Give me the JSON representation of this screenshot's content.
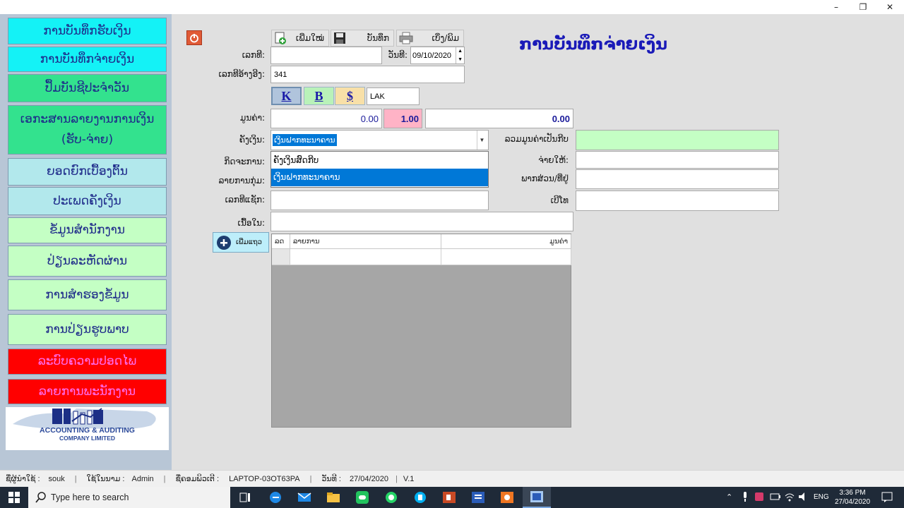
{
  "window": {
    "minimize": "–",
    "maximize": "❐",
    "close": "✕"
  },
  "sidebar": {
    "items": [
      {
        "label": "ການບັນທຶກຮັບເງິນ",
        "color": "#14f2f6"
      },
      {
        "label": "ການບັນທຶກຈ່າຍເງິນ",
        "color": "#14f2f6"
      },
      {
        "label": "ປຶ້ມບັນຊີປະຈຳວັນ",
        "color": "#33e28e"
      },
      {
        "label": "ເອກະສານລາຍງານການເງິນ (ຮັບ-ຈ່າຍ)",
        "color": "#33e28e"
      },
      {
        "label": "ຍອດຍົກເບື້ອງຕົ້ນ",
        "color": "#b2e8ec"
      },
      {
        "label": "ປະເພດຄັງເງິນ",
        "color": "#b2e8ec"
      },
      {
        "label": "ຂໍ້ມູນສຳນັກງານ",
        "color": "#c4ffc4"
      },
      {
        "label": "ປ່ຽນລະຫັດຜ່ານ",
        "color": "#c4ffc4"
      },
      {
        "label": "ການສຳຮອງຂໍ້ມູນ",
        "color": "#c4ffc4"
      },
      {
        "label": "ການປ່ຽນຮູບພາບ",
        "color": "#c4ffc4"
      },
      {
        "label": "ລະບົບຄວາມປອດໄພ",
        "color": "#ff0000"
      },
      {
        "label": "ລາຍການພະນັກງານ",
        "color": "#ff0000"
      }
    ],
    "logo": {
      "line1": "ACCOUNTING & AUDITING",
      "line2": "COMPANY LIMITED"
    }
  },
  "toolbar": {
    "new_label": "ເພີ່ມໃໝ່",
    "save_label": "ບັນທຶກ",
    "print_label": "ເບິ່ງ/ພິມ"
  },
  "form": {
    "title": "ການບັນທຶກຈ່າຍເງິນ",
    "number_label": "ເລກທີ:",
    "number_value": "",
    "date_label": "ວັນທີ:",
    "date_value": "09/10/2020",
    "ref_label": "ເລກທີອ້າງອີງ:",
    "ref_value": "341",
    "currency_k": "K",
    "currency_b": "B",
    "currency_s": "$",
    "currency_code": "LAK",
    "amount_label": "ມູນຄ່າ:",
    "amount_value": "0.00",
    "rate_value": "1.00",
    "total_value": "0.00",
    "cash_label": "ຄັງເງິນ:",
    "cash_selected": "ເງິນຝາກທະນາຄານ",
    "cash_options": [
      "ຄັງເງິນສົດກີບ",
      "ເງິນຝາກທະນາຄານ"
    ],
    "activity_label": "ກິດຈະການ:",
    "group_label": "ລາຍການກຸ່ມ:",
    "invoice_label": "ເລກທີແຊັກ:",
    "content_label": "ເນື້ອໃນ:",
    "total_kip_label": "ລວມມູນຄ່າເປັນກີບ",
    "payto_label": "ຈ່າຍໃຫ້:",
    "address_label": "ພາກສ່ວນ/ທີ່ຢູ່",
    "phone_label": "ເບີໂທ",
    "add_row_label": "ເພີ່ມແຖວ"
  },
  "grid": {
    "columns": [
      "ລດ",
      "ລາຍການ",
      "ມູນຄ່າ"
    ]
  },
  "status": {
    "user_label": "ຊື່ຜູ້ນຳໃຊ້ :",
    "user": "souk",
    "type_label": "ໃຊ້ໃນນາມ :",
    "type": "Admin",
    "computer_label": "ຊື່ຄອມພິວເຕີ :",
    "computer": "LAPTOP-03OT63PA",
    "date_label": "ວັນທີ :",
    "date": "27/04/2020",
    "version": "V.1"
  },
  "taskbar": {
    "search_placeholder": "Type here to search",
    "lang": "ENG",
    "time": "3:36 PM",
    "date": "27/04/2020"
  }
}
